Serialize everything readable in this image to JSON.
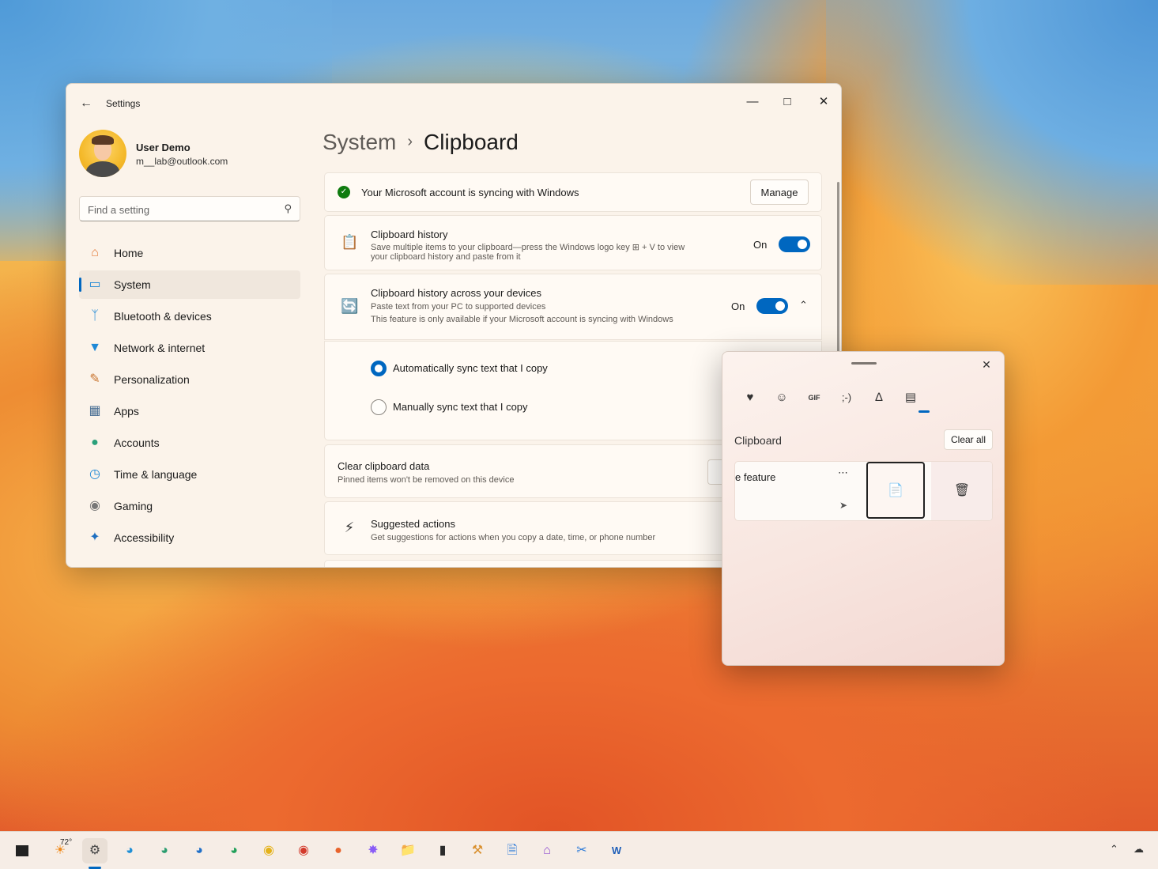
{
  "settings": {
    "app_title": "Settings",
    "user": {
      "name": "User Demo",
      "email": "m__lab@outlook.com"
    },
    "search": {
      "placeholder": "Find a setting"
    },
    "nav": [
      {
        "label": "Home",
        "icon": "home-icon"
      },
      {
        "label": "System",
        "icon": "system-icon",
        "active": true
      },
      {
        "label": "Bluetooth & devices",
        "icon": "bluetooth-icon"
      },
      {
        "label": "Network & internet",
        "icon": "wifi-icon"
      },
      {
        "label": "Personalization",
        "icon": "brush-icon"
      },
      {
        "label": "Apps",
        "icon": "apps-icon"
      },
      {
        "label": "Accounts",
        "icon": "accounts-icon"
      },
      {
        "label": "Time & language",
        "icon": "globe-clock-icon"
      },
      {
        "label": "Gaming",
        "icon": "gamepad-icon"
      },
      {
        "label": "Accessibility",
        "icon": "accessibility-icon"
      }
    ],
    "breadcrumb": {
      "parent": "System",
      "current": "Clipboard"
    },
    "sync_banner": {
      "text": "Your Microsoft account is syncing with Windows",
      "button": "Manage"
    },
    "clipboard_history": {
      "title": "Clipboard history",
      "desc_line1": "Save multiple items to your clipboard—press the Windows logo key ⊞ + V to view",
      "desc_line2": "your clipboard history and paste from it",
      "state": "On"
    },
    "across_devices": {
      "title": "Clipboard history across your devices",
      "desc_line1": "Paste text from your PC to supported devices",
      "desc_line2": "This feature is only available if your Microsoft account is syncing with Windows",
      "state": "On"
    },
    "sync_options": {
      "auto": "Automatically sync text that I copy",
      "manual": "Manually sync text that I copy"
    },
    "clear_data": {
      "title": "Clear clipboard data",
      "desc": "Pinned items won't be removed on this device"
    },
    "suggested": {
      "title": "Suggested actions",
      "desc": "Get suggestions for actions when you copy a date, time, or phone number"
    }
  },
  "flyout": {
    "tabs": [
      "favorites-icon",
      "emoji-icon",
      "gif-icon",
      "kaomoji-icon",
      "symbols-icon",
      "clipboard-icon"
    ],
    "gif_label": "GIF",
    "kaomoji_label": ";-)",
    "section": "Clipboard",
    "clear_all": "Clear all",
    "item_text": "e feature"
  },
  "taskbar": {
    "weather_temp": "72°"
  },
  "colors": {
    "accent": "#0067c0",
    "success": "#0f7b0f"
  }
}
